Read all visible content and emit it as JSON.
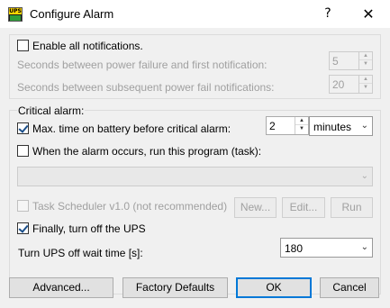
{
  "window": {
    "title": "Configure Alarm",
    "app_icon_text": "UPS",
    "help_glyph": "?",
    "close_glyph": "✕"
  },
  "notifications": {
    "enable_label": "Enable all notifications.",
    "enable_checked": false,
    "first_label": "Seconds between power failure and first notification:",
    "first_value": "5",
    "subsequent_label": "Seconds between subsequent power fail notifications:",
    "subsequent_value": "20"
  },
  "critical": {
    "group_label": "Critical alarm:",
    "max_time_label": "Max. time on battery before critical alarm:",
    "max_time_checked": true,
    "max_time_value": "2",
    "unit_value": "minutes",
    "run_program_label": "When the alarm occurs, run this program (task):",
    "run_program_checked": false,
    "program_value": "",
    "task_scheduler_label": "Task Scheduler v1.0 (not recommended)",
    "task_scheduler_checked": false,
    "new_button": "New...",
    "edit_button": "Edit...",
    "run_button": "Run",
    "turn_off_label": "Finally, turn off the UPS",
    "turn_off_checked": true,
    "wait_time_label": "Turn UPS off wait time [s]:",
    "wait_time_value": "180"
  },
  "footer": {
    "advanced": "Advanced...",
    "factory_defaults": "Factory Defaults",
    "ok": "OK",
    "cancel": "Cancel"
  },
  "icons": {
    "spin_up": "▲",
    "spin_down": "▼",
    "combo_arrow": "⌄"
  },
  "colors": {
    "panel": "#f0f0f0",
    "default_button_border": "#0078d7",
    "checkmark": "#1b4f8a"
  }
}
